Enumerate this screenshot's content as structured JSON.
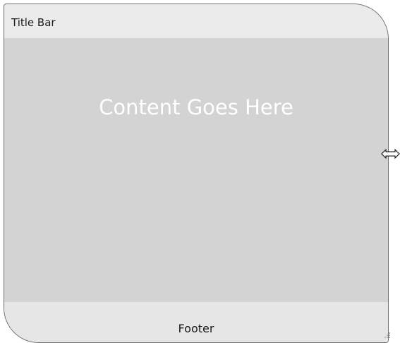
{
  "window": {
    "title": "Title Bar",
    "content_text": "Content Goes Here",
    "footer_text": "Footer"
  },
  "icons": {
    "resize_cursor": "horizontal-resize-cursor-icon",
    "resize_grip": "resize-grip-icon"
  },
  "colors": {
    "title_bar_bg": "#ebebeb",
    "content_bg": "#d3d3d3",
    "footer_bg": "#e6e6e6",
    "border": "#6e6e6e",
    "content_text": "#ffffff"
  }
}
